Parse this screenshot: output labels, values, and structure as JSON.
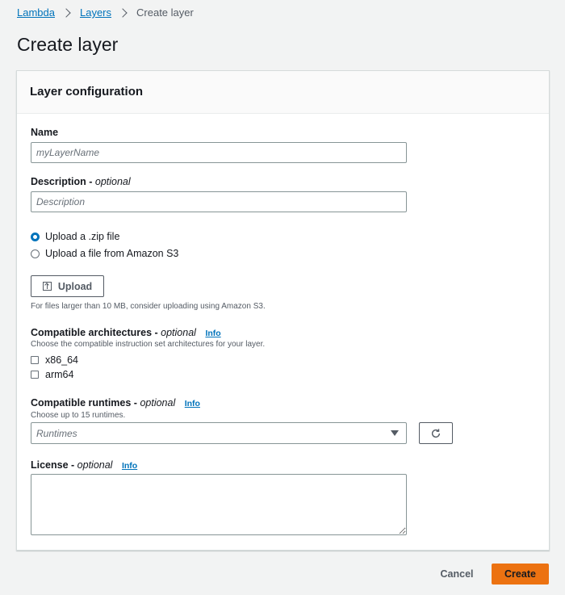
{
  "breadcrumb": {
    "items": [
      {
        "label": "Lambda"
      },
      {
        "label": "Layers"
      }
    ],
    "current": "Create layer"
  },
  "page": {
    "title": "Create layer"
  },
  "panel": {
    "title": "Layer configuration",
    "name": {
      "label": "Name",
      "placeholder": "myLayerName"
    },
    "description": {
      "label": "Description",
      "optional": "optional",
      "placeholder": "Description"
    },
    "upload_source": {
      "options": [
        {
          "label": "Upload a .zip file",
          "checked": true
        },
        {
          "label": "Upload a file from Amazon S3",
          "checked": false
        }
      ]
    },
    "upload": {
      "button_label": "Upload",
      "hint": "For files larger than 10 MB, consider uploading using Amazon S3."
    },
    "architectures": {
      "label": "Compatible architectures",
      "optional": "optional",
      "info": "Info",
      "hint": "Choose the compatible instruction set architectures for your layer.",
      "options": [
        {
          "label": "x86_64",
          "checked": false
        },
        {
          "label": "arm64",
          "checked": false
        }
      ]
    },
    "runtimes": {
      "label": "Compatible runtimes",
      "optional": "optional",
      "info": "Info",
      "hint": "Choose up to 15 runtimes.",
      "placeholder": "Runtimes"
    },
    "license": {
      "label": "License",
      "optional": "optional",
      "info": "Info"
    }
  },
  "footer": {
    "cancel_label": "Cancel",
    "create_label": "Create"
  },
  "colors": {
    "link": "#0073bb",
    "primary_button": "#ec7211",
    "text": "#16191f",
    "muted": "#545b64"
  }
}
